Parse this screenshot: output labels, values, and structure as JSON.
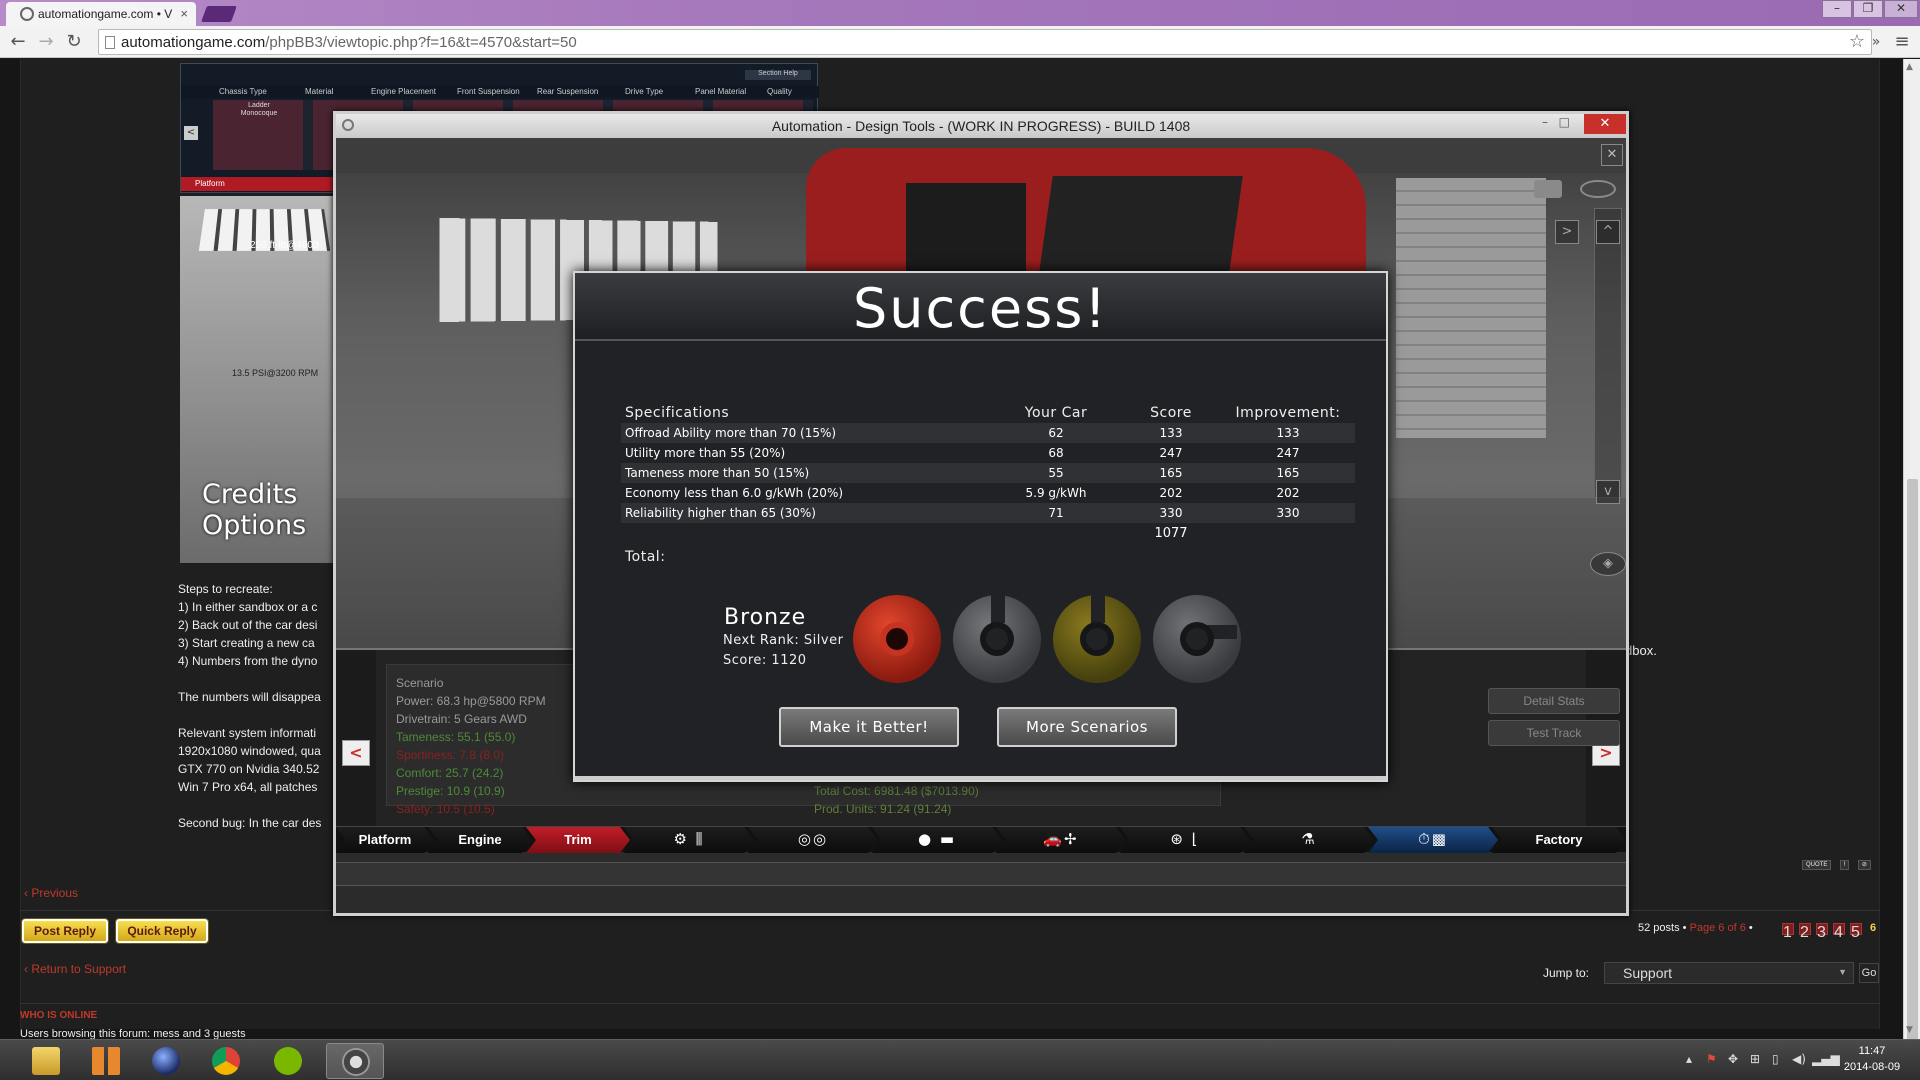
{
  "browser": {
    "tab_title": "automationgame.com • V",
    "tab_close": "×",
    "url_host": "automationgame.com",
    "url_path": "/phpBB3/viewtopic.php?f=16&t=4570&start=50",
    "window_controls": [
      "–",
      "❐",
      "✕"
    ],
    "nav": {
      "back": "←",
      "forward": "→",
      "reload": "↻"
    },
    "star": "☆",
    "more": "»",
    "menu": "≡"
  },
  "post": {
    "screenshot_headers": [
      "Chassis Type",
      "Material",
      "Engine Placement",
      "Front Suspension",
      "Rear Suspension",
      "Drive Type",
      "Panel Material",
      "Quality"
    ],
    "screenshot_first_cells": [
      "Ladder",
      "Monocoque"
    ],
    "screenshot_tab": "Platform",
    "screenshot_section_help": "Section Help",
    "dyno_torque": "256 ft-lb@4600",
    "dyno_boost": "13.5 PSI@3200 RPM",
    "menu_credits": "Credits",
    "menu_options": "Options",
    "lines": [
      "Steps to recreate:",
      "1) In either sandbox or a c",
      "2) Back out of the car desi",
      "3) Start creating a new ca",
      "4) Numbers from the dyno",
      "",
      "The numbers will disappea",
      "",
      "Relevant system informati",
      "1920x1080 windowed, qua",
      "GTX 770 on Nvidia 340.52",
      "Win 7 Pro x64, all patches",
      "",
      "Second bug: In the car des"
    ],
    "line_suffix": "dbox."
  },
  "game": {
    "window_title": "Automation - Design Tools - (WORK IN PROGRESS) - BUILD 1408",
    "close": "✕",
    "scene_close": "✕",
    "panel": {
      "heading": "Scenario",
      "power": "Power: 68.3 hp@5800 RPM",
      "drivetrain": "Drivetrain: 5 Gears AWD",
      "tameness": "Tameness: 55.1 (55.0)",
      "sportiness": "Sportiness: 7.8 (8.0)",
      "comfort": "Comfort: 25.7 (24.2)",
      "prestige": "Prestige: 10.9 (10.9)",
      "safety": "Safety: 10.5 (10.5)",
      "total_cost": "Total Cost: 6981.48 ($7013.90)",
      "prod_units": "Prod. Units: 91.24 (91.24)",
      "detail_stats": "Detail Stats",
      "test_track": "Test Track",
      "prev": "<",
      "next": ">"
    },
    "steps": [
      {
        "label": "Platform",
        "type": "text"
      },
      {
        "label": "Engine",
        "type": "text"
      },
      {
        "label": "Trim",
        "type": "text",
        "active": true
      },
      {
        "label": "⚙ ⫼",
        "type": "icon",
        "icon": "gearbox-icon"
      },
      {
        "label": "◎◎",
        "type": "icon",
        "icon": "wheels-icon"
      },
      {
        "label": "● ▬",
        "type": "icon",
        "icon": "suspension-icon"
      },
      {
        "label": "🚗✢",
        "type": "icon",
        "icon": "aero-icon"
      },
      {
        "label": "⊛ ⌊",
        "type": "icon",
        "icon": "interior-icon"
      },
      {
        "label": "⚗",
        "type": "icon",
        "icon": "tune-icon"
      },
      {
        "label": "⏱▩",
        "type": "icon",
        "icon": "test-icon",
        "blue": true
      },
      {
        "label": "Factory",
        "type": "text"
      }
    ],
    "accent": "#c11d27"
  },
  "dialog": {
    "title": "Success!",
    "columns": [
      "Specifications",
      "Your Car",
      "Score",
      "Improvement:"
    ],
    "rows": [
      [
        "Offroad Ability more than 70 (15%)",
        "62",
        "133",
        "133"
      ],
      [
        "Utility more than 55 (20%)",
        "68",
        "247",
        "247"
      ],
      [
        "Tameness more than 50 (15%)",
        "55",
        "165",
        "165"
      ],
      [
        "Economy less than 6.0 g/kWh (20%)",
        "5.9 g/kWh",
        "202",
        "202"
      ],
      [
        "Reliability higher than 65 (30%)",
        "71",
        "330",
        "330"
      ]
    ],
    "total_value": "1077",
    "total_label": "Total:",
    "rank": "Bronze",
    "next_rank": "Next Rank: Silver",
    "score": "Score: 1120",
    "medals": [
      {
        "name": "bronze",
        "color": "#c3301e",
        "achieved": true
      },
      {
        "name": "silver",
        "color": "#5f6064",
        "achieved": false
      },
      {
        "name": "gold",
        "color": "#6f6114",
        "achieved": false
      },
      {
        "name": "platinum",
        "color": "#5b5d62",
        "achieved": false
      }
    ],
    "btn_better": "Make it Better!",
    "btn_scenarios": "More Scenarios"
  },
  "forum": {
    "previous": "Previous",
    "post_reply": "Post Reply",
    "quick_reply": "Quick Reply",
    "posts_count": "52 posts",
    "page_of": "Page 6 of 6",
    "pages": [
      "1",
      "2",
      "3",
      "4",
      "5"
    ],
    "current_page": "6",
    "return_link": "Return to Support",
    "jump_to": "Jump to:",
    "jump_value": "Support",
    "go": "Go",
    "who_online": "WHO IS ONLINE",
    "browsing": "Users browsing this forum: mess and 3 guests",
    "quote_labels": [
      "QUOTE",
      "!",
      "⊘"
    ]
  },
  "taskbar": {
    "time": "11:47",
    "date": "2014-08-09"
  }
}
